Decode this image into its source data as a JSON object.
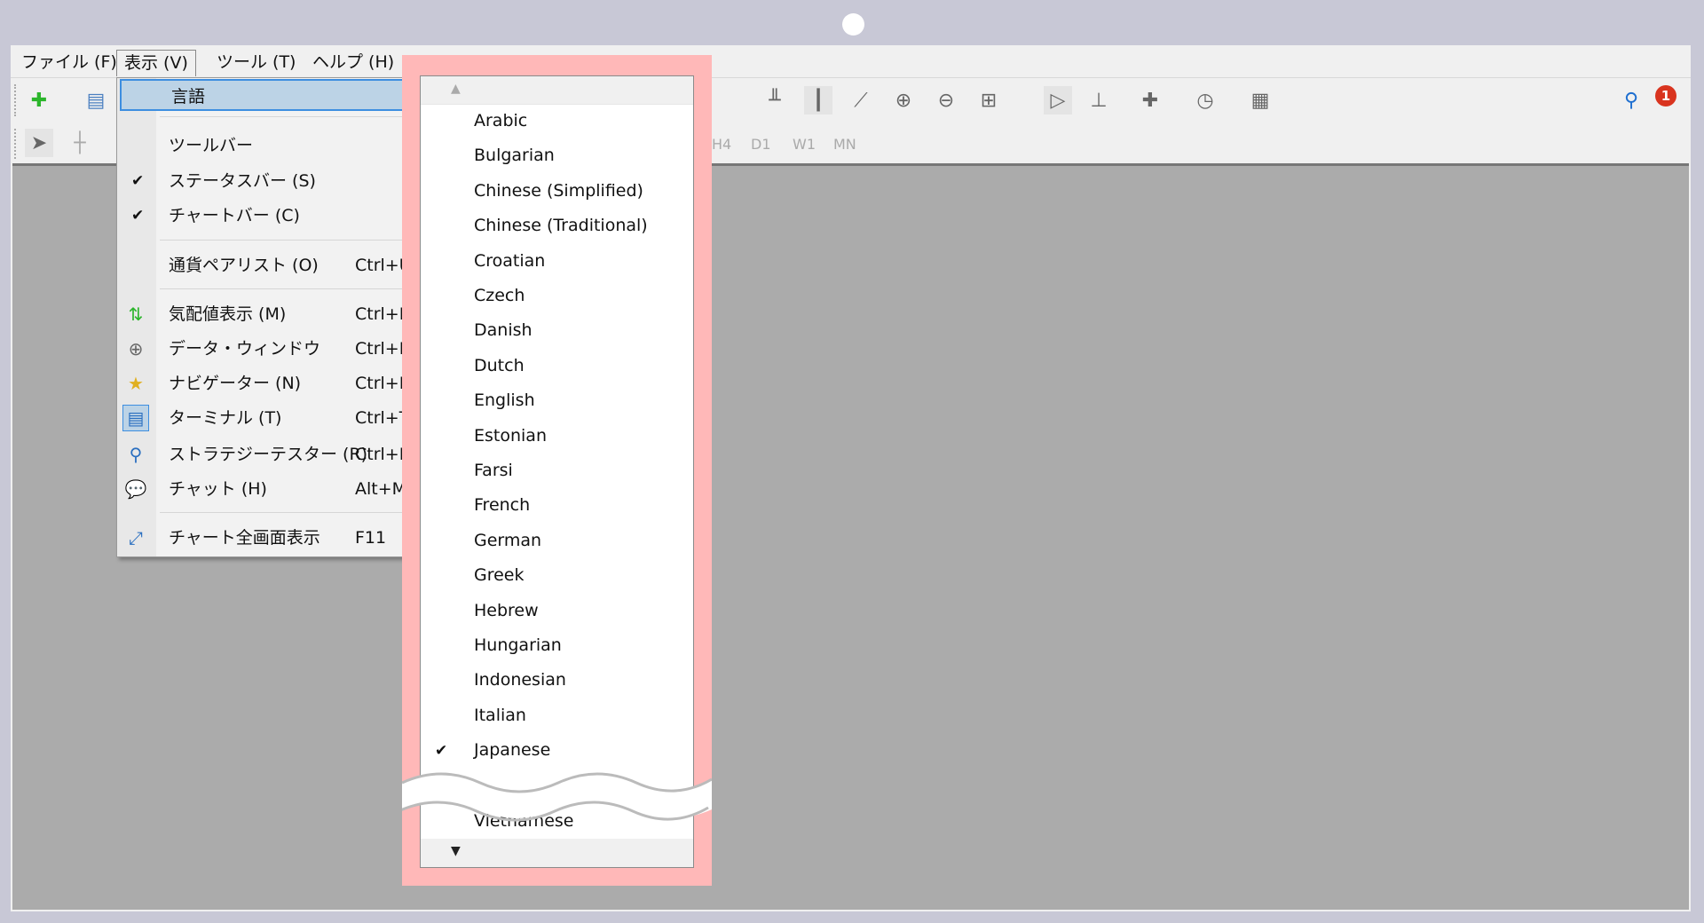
{
  "menubar": {
    "items": [
      "ファイル (F)",
      "表示 (V)",
      "ツール (T)",
      "ヘルプ (H)"
    ],
    "open_index": 1
  },
  "timeframes": [
    "H4",
    "D1",
    "W1",
    "MN"
  ],
  "notification_count": "1",
  "view_menu": {
    "items": [
      {
        "label": "言語",
        "highlighted": true
      },
      {
        "label": "ツールバー"
      },
      {
        "label": "ステータスバー (S)",
        "checked": true
      },
      {
        "label": "チャートバー (C)",
        "checked": true
      },
      {
        "label": "通貨ペアリスト (O)",
        "shortcut": "Ctrl+U"
      },
      {
        "label": "気配値表示 (M)",
        "shortcut": "Ctrl+M",
        "icon": "market-watch-icon"
      },
      {
        "label": "データ・ウィンドウ",
        "shortcut": "Ctrl+D",
        "icon": "crosshair-icon"
      },
      {
        "label": "ナビゲーター (N)",
        "shortcut": "Ctrl+N",
        "icon": "navigator-star-icon"
      },
      {
        "label": "ターミナル (T)",
        "shortcut": "Ctrl+T",
        "icon": "terminal-icon"
      },
      {
        "label": "ストラテジーテスター (R)",
        "shortcut": "Ctrl+R",
        "icon": "strategy-tester-icon"
      },
      {
        "label": "チャット (H)",
        "shortcut": "Alt+M",
        "icon": "chat-icon"
      },
      {
        "label": "チャート全画面表示",
        "shortcut": "F11",
        "icon": "fullscreen-icon"
      }
    ]
  },
  "language_menu": {
    "items": [
      "Arabic",
      "Bulgarian",
      "Chinese (Simplified)",
      "Chinese (Traditional)",
      "Croatian",
      "Czech",
      "Danish",
      "Dutch",
      "English",
      "Estonian",
      "Farsi",
      "French",
      "German",
      "Greek",
      "Hebrew",
      "Hungarian",
      "Indonesian",
      "Italian",
      "Japanese"
    ],
    "checked": "Japanese",
    "last_item": "Vietnamese"
  },
  "colors": {
    "highlight": "#bcd3e6",
    "callout": "#ffb8b8",
    "chart_bg": "#ababab",
    "badge": "#d9341f"
  }
}
